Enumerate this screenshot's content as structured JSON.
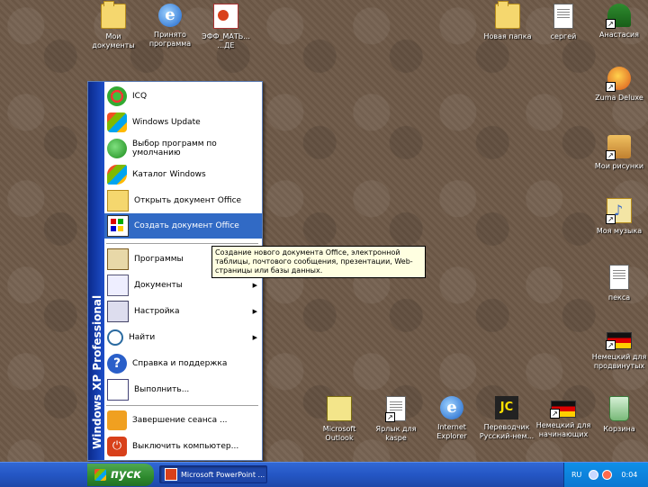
{
  "desktop": {
    "icons": [
      {
        "label": "Мои документы",
        "icon": "folder-icon"
      },
      {
        "label": "Принято программа",
        "icon": "internet-explorer-icon"
      },
      {
        "label": "ЭФФ_МАТЬ... ...ДЕ",
        "icon": "powerpoint-doc-icon"
      },
      {
        "label": "Новая папка",
        "icon": "folder-icon"
      },
      {
        "label": "сергей",
        "icon": "document-icon"
      },
      {
        "label": "Анастасия",
        "icon": "tree-icon"
      },
      {
        "label": "Zuma Deluxe",
        "icon": "zuma-icon"
      },
      {
        "label": "Мои рисунки",
        "icon": "pictures-folder-icon"
      },
      {
        "label": "Моя музыка",
        "icon": "music-folder-icon"
      },
      {
        "label": "пекса",
        "icon": "document-icon"
      },
      {
        "label": "Немецкий для продвинутых",
        "icon": "german-flag-icon"
      },
      {
        "label": "Microsoft Outlook",
        "icon": "outlook-icon"
      },
      {
        "label": "Ярлык для kaspe",
        "icon": "program-icon"
      },
      {
        "label": "Internet Explorer",
        "icon": "internet-explorer-icon"
      },
      {
        "label": "Переводчик Русский-нем...",
        "icon": "translator-icon"
      },
      {
        "label": "Немецкий для начинающих",
        "icon": "german-flag-icon"
      },
      {
        "label": "Корзина",
        "icon": "recycle-bin-icon"
      }
    ]
  },
  "start_menu": {
    "banner": "Windows XP Professional",
    "pinned": [
      {
        "label": "ICQ",
        "icon": "icq-icon"
      },
      {
        "label": "Windows Update",
        "icon": "windows-update-icon"
      },
      {
        "label": "Выбор программ по умолчанию",
        "icon": "default-programs-icon"
      },
      {
        "label": "Каталог Windows",
        "icon": "windows-catalog-icon"
      },
      {
        "label": "Открыть документ Office",
        "icon": "open-office-doc-icon"
      },
      {
        "label": "Создать документ Office",
        "icon": "new-office-doc-icon"
      }
    ],
    "items": [
      {
        "label": "Программы",
        "icon": "programs-icon",
        "arrow": "▶"
      },
      {
        "label": "Документы",
        "icon": "documents-icon",
        "arrow": "▶"
      },
      {
        "label": "Настройка",
        "icon": "settings-icon",
        "arrow": "▶"
      },
      {
        "label": "Найти",
        "icon": "search-icon",
        "arrow": "▶"
      },
      {
        "label": "Справка и поддержка",
        "icon": "help-icon"
      },
      {
        "label": "Выполнить...",
        "icon": "run-icon"
      },
      {
        "label": "Завершение сеанса ...",
        "icon": "log-off-icon"
      },
      {
        "label": "Выключить компьютер...",
        "icon": "shut-down-icon"
      }
    ]
  },
  "tooltip": {
    "text": "Создание нового документа Office, электронной таблицы, почтового сообщения, презентации, Web-страницы или базы данных."
  },
  "taskbar": {
    "start_label": "пуск",
    "tasks": [
      {
        "label": "Microsoft PowerPoint ..."
      }
    ],
    "tray": {
      "language": "RU",
      "time": "0:04"
    }
  }
}
